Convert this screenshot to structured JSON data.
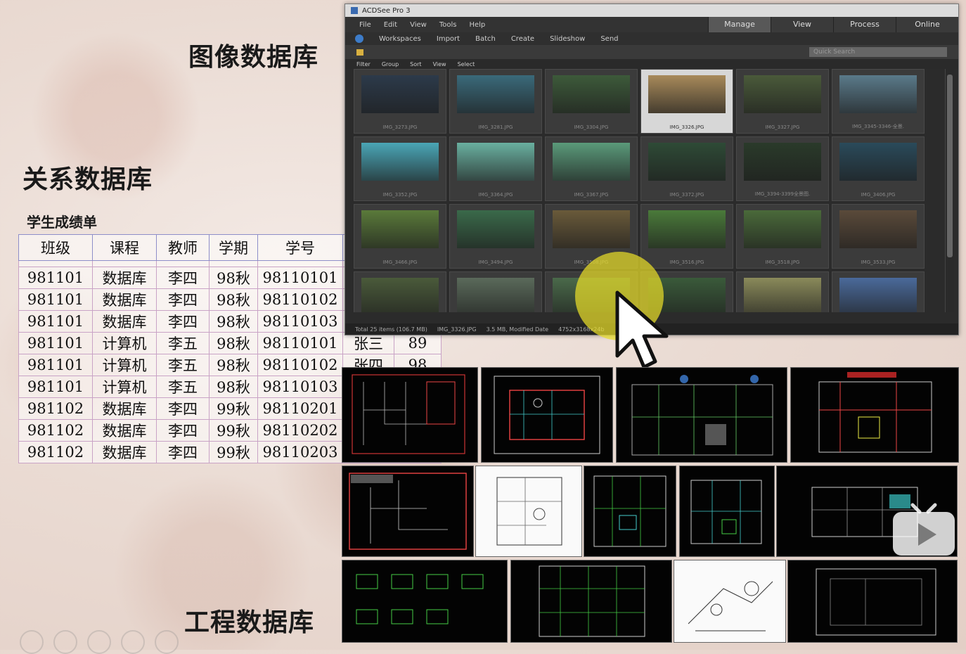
{
  "headings": {
    "image_db": "图像数据库",
    "relational_db": "关系数据库",
    "engineering_db": "工程数据库"
  },
  "grade_table": {
    "caption": "学生成绩单",
    "headers": [
      "班级",
      "课程",
      "教师",
      "学期",
      "学号",
      "",
      ""
    ],
    "rows": [
      [
        "981101",
        "数据库",
        "李四",
        "98秋",
        "98110101",
        "",
        ""
      ],
      [
        "981101",
        "数据库",
        "李四",
        "98秋",
        "98110102",
        "",
        ""
      ],
      [
        "981101",
        "数据库",
        "李四",
        "98秋",
        "98110103",
        "",
        ""
      ],
      [
        "981101",
        "计算机",
        "李五",
        "98秋",
        "98110101",
        "张三",
        "89"
      ],
      [
        "981101",
        "计算机",
        "李五",
        "98秋",
        "98110102",
        "张四",
        "98"
      ],
      [
        "981101",
        "计算机",
        "李五",
        "98秋",
        "98110103",
        "",
        ""
      ],
      [
        "981102",
        "数据库",
        "李四",
        "99秋",
        "98110201",
        "",
        ""
      ],
      [
        "981102",
        "数据库",
        "李四",
        "99秋",
        "98110202",
        "",
        ""
      ],
      [
        "981102",
        "数据库",
        "李四",
        "99秋",
        "98110203",
        "",
        ""
      ]
    ]
  },
  "acdsee": {
    "title": "ACDSee Pro 3",
    "menu": [
      "File",
      "Edit",
      "View",
      "Tools",
      "Help"
    ],
    "modes": [
      "Manage",
      "View",
      "Process",
      "Online"
    ],
    "active_mode": "Manage",
    "toolbar": [
      "Workspaces",
      "Import",
      "Batch",
      "Create",
      "Slideshow",
      "Send"
    ],
    "filters": [
      "Filter",
      "Group",
      "Sort",
      "View",
      "Select"
    ],
    "search_placeholder": "Quick Search",
    "thumbnails": [
      {
        "name": "IMG_3273.JPG",
        "color": "#2c3a4a"
      },
      {
        "name": "IMG_3281.JPG",
        "color": "#3a6a7a"
      },
      {
        "name": "IMG_3304.JPG",
        "color": "#3d5a3a"
      },
      {
        "name": "IMG_3326.JPG",
        "color": "#a88a5a",
        "selected": true
      },
      {
        "name": "IMG_3327.JPG",
        "color": "#4a5a3a"
      },
      {
        "name": "IMG_3345-3346-全景.",
        "color": "#5a7a8a"
      },
      {
        "name": "IMG_3352.JPG",
        "color": "#4aa6b6"
      },
      {
        "name": "IMG_3364.JPG",
        "color": "#6ab0a0"
      },
      {
        "name": "IMG_3367.JPG",
        "color": "#5a9a7a"
      },
      {
        "name": "IMG_3372.JPG",
        "color": "#2e4a36"
      },
      {
        "name": "IMG_3394-3399全景图.",
        "color": "#2a3a2a"
      },
      {
        "name": "IMG_3406.JPG",
        "color": "#2a4a5a"
      },
      {
        "name": "IMG_3466.JPG",
        "color": "#5a7a3a"
      },
      {
        "name": "IMG_3494.JPG",
        "color": "#3a6a4a"
      },
      {
        "name": "IMG_3508.JPG",
        "color": "#6a5a3a"
      },
      {
        "name": "IMG_3516.JPG",
        "color": "#4a7a3a"
      },
      {
        "name": "IMG_3518.JPG",
        "color": "#4a6a3a"
      },
      {
        "name": "IMG_3533.JPG",
        "color": "#5a4a3a"
      },
      {
        "name": "",
        "color": "#4a5a3a"
      },
      {
        "name": "",
        "color": "#5a6a5a"
      },
      {
        "name": "",
        "color": "#4a6a4a"
      },
      {
        "name": "",
        "color": "#3a5a3a"
      },
      {
        "name": "",
        "color": "#8a8a5a"
      },
      {
        "name": "",
        "color": "#4a6a9a"
      }
    ],
    "status": [
      "Total 25 items (106.7 MB)",
      "IMG_3326.JPG",
      "3.5 MB, Modified Date",
      "4752x3168x24b"
    ]
  }
}
